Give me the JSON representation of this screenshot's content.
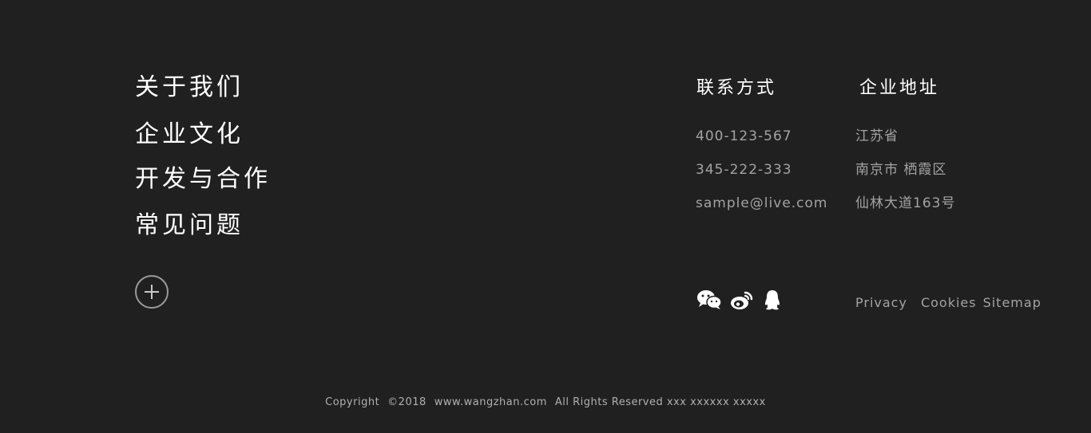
{
  "nav": {
    "items": [
      {
        "label": "关于我们"
      },
      {
        "label": "企业文化"
      },
      {
        "label": "开发与合作"
      },
      {
        "label": "常见问题"
      }
    ]
  },
  "more_button": {
    "icon": "plus-circle-icon"
  },
  "contact": {
    "title": "联系方式",
    "phone1": "400-123-567",
    "phone2": "345-222-333",
    "email": "sample@live.com"
  },
  "address": {
    "title": "企业地址",
    "line1": "江苏省",
    "line2": "南京市 栖霞区",
    "line3": "仙林大道163号"
  },
  "social": {
    "icons": [
      "wechat-icon",
      "weibo-icon",
      "qq-icon"
    ]
  },
  "links": {
    "privacy": "Privacy",
    "cookies": "Cookies",
    "sitemap": "Sitemap"
  },
  "copyright": {
    "copyright_label": "Copyright",
    "year": "©2018",
    "site": "www.wangzhan.com",
    "rights": "All Rights Reserved xxx xxxxxx xxxxx"
  },
  "colors": {
    "background": "#202020",
    "primary_text": "#ffffff",
    "secondary_text": "#a3a3a3"
  }
}
